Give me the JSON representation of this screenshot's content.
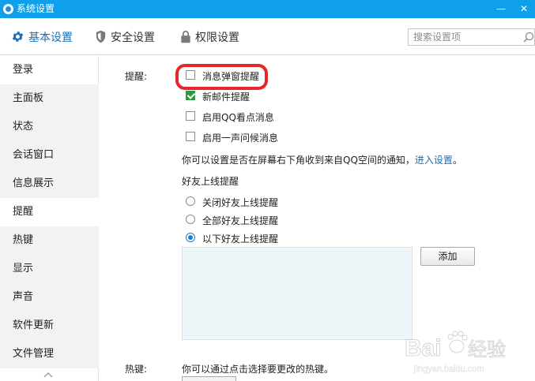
{
  "window": {
    "title": "系统设置",
    "minimize_label": "—",
    "close_label": "✕"
  },
  "toolbar": {
    "tabs": [
      {
        "label": "基本设置",
        "icon": "gear-icon",
        "active": true
      },
      {
        "label": "安全设置",
        "icon": "shield-icon",
        "active": false
      },
      {
        "label": "权限设置",
        "icon": "lock-icon",
        "active": false
      }
    ],
    "search": {
      "placeholder": "搜索设置项",
      "value": ""
    }
  },
  "sidebar": {
    "items": [
      {
        "label": "登录"
      },
      {
        "label": "主面板"
      },
      {
        "label": "状态"
      },
      {
        "label": "会话窗口"
      },
      {
        "label": "信息展示"
      },
      {
        "label": "提醒",
        "active": true
      },
      {
        "label": "热键"
      },
      {
        "label": "显示"
      },
      {
        "label": "声音"
      },
      {
        "label": "软件更新"
      },
      {
        "label": "文件管理"
      }
    ]
  },
  "main": {
    "reminder": {
      "section_label": "提醒:",
      "options": [
        {
          "label": "消息弹窗提醒",
          "checked": false,
          "highlighted": true
        },
        {
          "label": "新邮件提醒",
          "checked": true
        },
        {
          "label": "启用QQ看点消息",
          "checked": false
        },
        {
          "label": "启用一声问候消息",
          "checked": false
        }
      ],
      "notice_text": "你可以设置是否在屏幕右下角收到来自QQ空间的通知，",
      "notice_link": "进入设置",
      "notice_end": "。"
    },
    "friend_online": {
      "heading": "好友上线提醒",
      "options": [
        {
          "label": "关闭好友上线提醒",
          "selected": false
        },
        {
          "label": "全部好友上线提醒",
          "selected": false
        },
        {
          "label": "以下好友上线提醒",
          "selected": true
        }
      ],
      "add_button": "添加"
    },
    "hotkey": {
      "section_label": "热键:",
      "description": "你可以通过点击选择要更改的热键。"
    }
  },
  "watermark": {
    "brand": "Bai",
    "brand_cn": "经验",
    "url": "jingyan.baidu.com"
  },
  "colors": {
    "titlebar": "#0fa0ec",
    "accent": "#1a6fb5",
    "highlight": "#e6262a",
    "checkbox_checked": "#2f9a3c"
  }
}
